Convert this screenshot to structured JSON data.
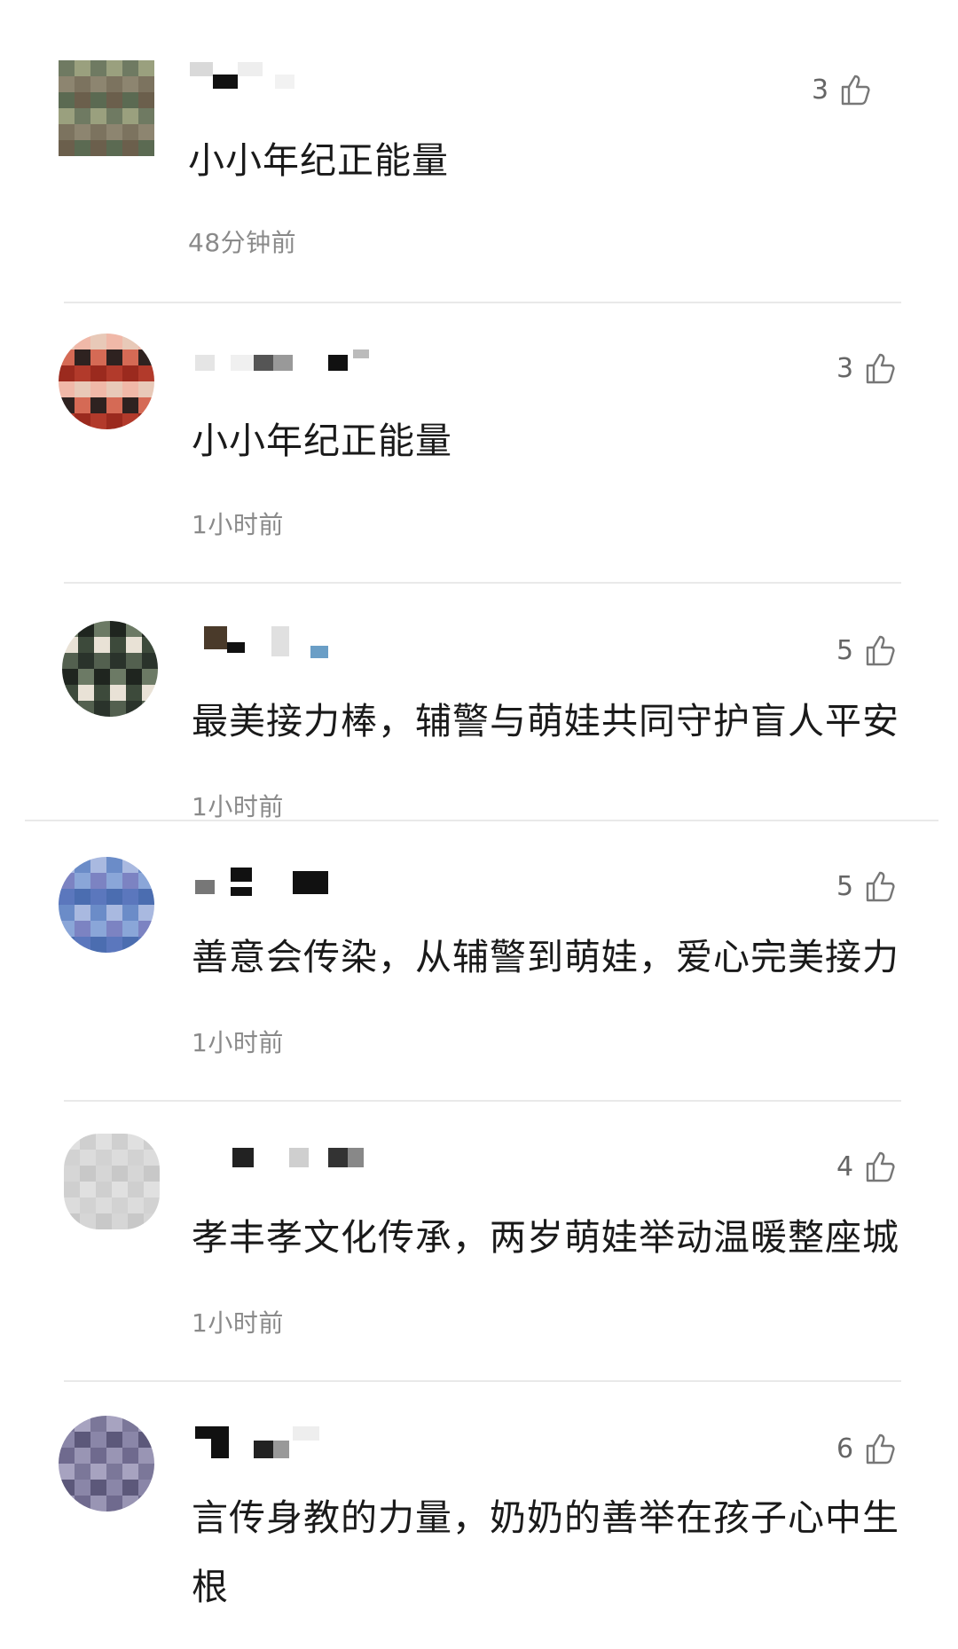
{
  "comments": [
    {
      "text": "小小年纪正能量",
      "time": "48分钟前",
      "likes": "3",
      "avatar_colors": [
        "#6f7a62",
        "#8d8570",
        "#5b6a52",
        "#9aa07e",
        "#7c735f",
        "#6b5f4c"
      ]
    },
    {
      "text": "小小年纪正能量",
      "time": "1小时前",
      "likes": "3",
      "avatar_colors": [
        "#b23a2b",
        "#e8c9b8",
        "#d56a55",
        "#9b2a1e",
        "#f0b8a8",
        "#2e2220"
      ]
    },
    {
      "text": "最美接力棒，辅警与萌娃共同守护盲人平安",
      "time": "1小时前",
      "likes": "5",
      "avatar_colors": [
        "#3d4a3b",
        "#2a332b",
        "#6c7a65",
        "#e9e2d6",
        "#53604f",
        "#1f251f"
      ]
    },
    {
      "text": "善意会传染，从辅警到萌娃，爱心完美接力",
      "time": "1小时前",
      "likes": "5",
      "avatar_colors": [
        "#6b8cc8",
        "#8aa6d8",
        "#4b6db0",
        "#a9b9e0",
        "#7c83c2",
        "#5b77bd"
      ]
    },
    {
      "text": "孝丰孝文化传承，两岁萌娃举动温暖整座城",
      "time": "1小时前",
      "likes": "4",
      "avatar_colors": [
        "#d6d6d6",
        "#cfcfcf",
        "#dcdcdc",
        "#c8c8c8",
        "#e0e0e0",
        "#d2d2d2"
      ]
    },
    {
      "text": "言传身教的力量，奶奶的善举在孩子心中生根",
      "time": "",
      "likes": "6",
      "avatar_colors": [
        "#8a86a8",
        "#6f6a8e",
        "#a7a3c0",
        "#5c587a",
        "#9995b4",
        "#7b7799"
      ]
    }
  ],
  "icons": {
    "like": "thumbs-up-icon"
  },
  "colors": {
    "text": "#1a1a1a",
    "meta": "#8a8a8a",
    "divider": "#e9e9e9"
  }
}
